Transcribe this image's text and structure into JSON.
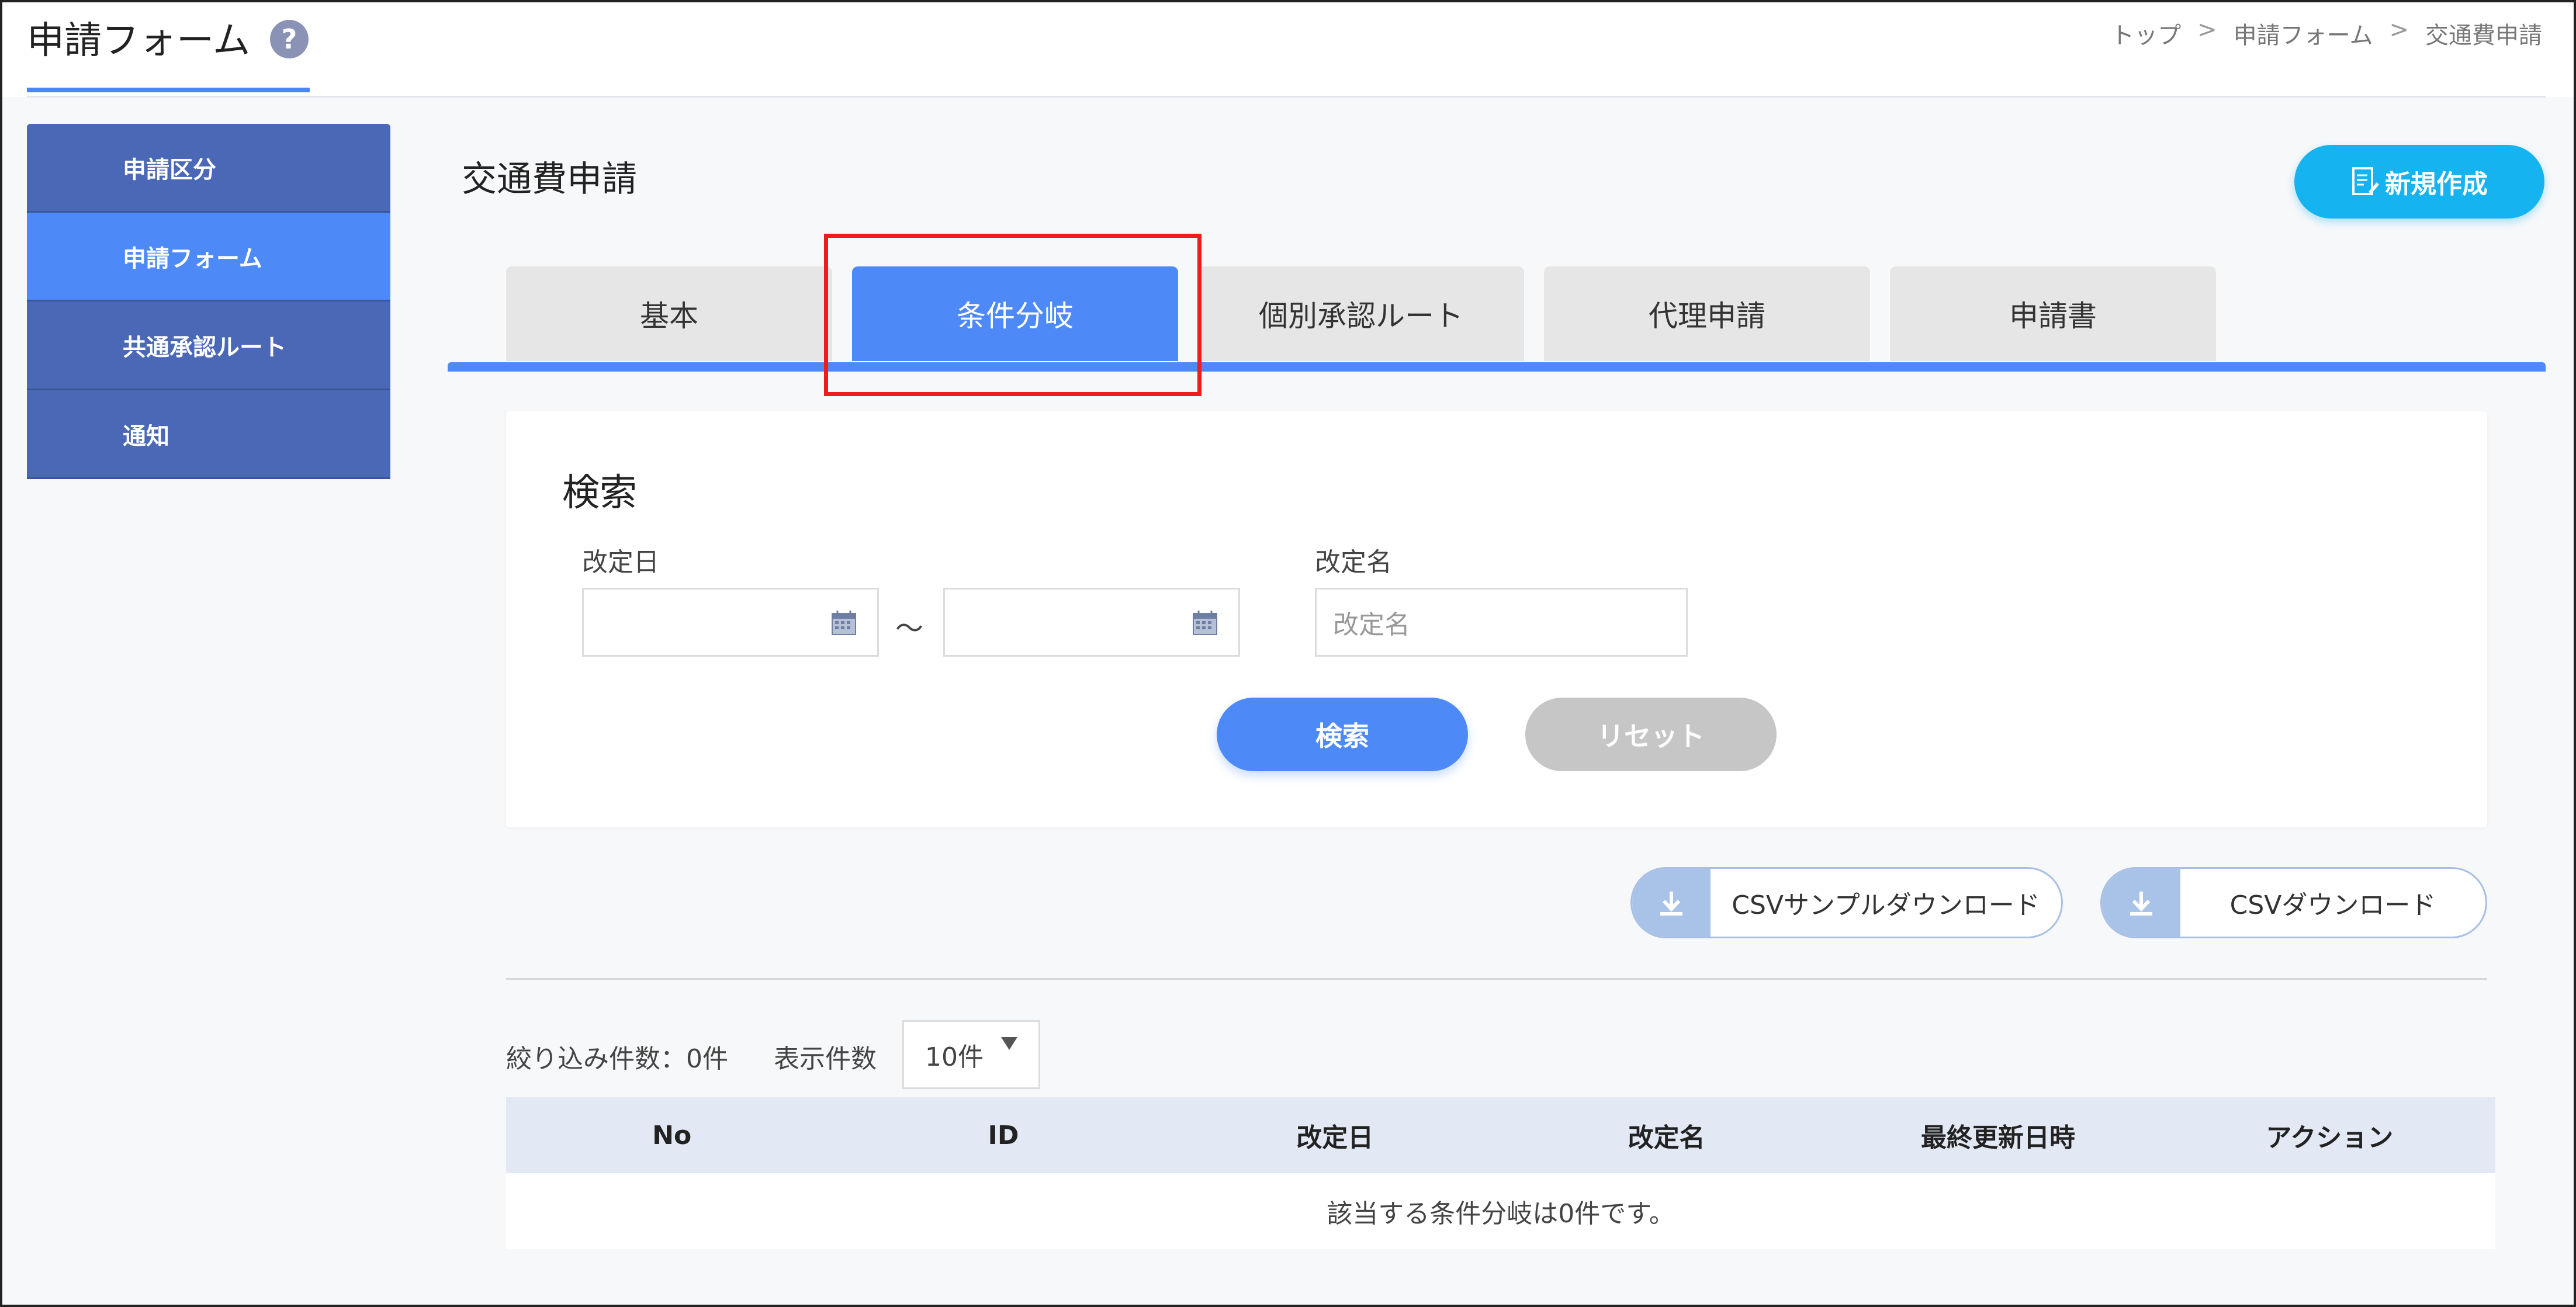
{
  "header": {
    "title": "申請フォーム",
    "help": "?",
    "breadcrumb": [
      "トップ",
      "申請フォーム",
      "交通費申請"
    ],
    "breadcrumb_sep": ">"
  },
  "sidebar": {
    "items": [
      {
        "label": "申請区分",
        "active": false
      },
      {
        "label": "申請フォーム",
        "active": true
      },
      {
        "label": "共通承認ルート",
        "active": false
      },
      {
        "label": "通知",
        "active": false
      }
    ]
  },
  "main": {
    "title": "交通費申請",
    "new_button": "新規作成",
    "tabs": [
      {
        "label": "基本",
        "active": false
      },
      {
        "label": "条件分岐",
        "active": true
      },
      {
        "label": "個別承認ルート",
        "active": false
      },
      {
        "label": "代理申請",
        "active": false
      },
      {
        "label": "申請書",
        "active": false
      }
    ]
  },
  "search": {
    "title": "検索",
    "date_label": "改定日",
    "date_from_value": "",
    "date_to_value": "",
    "range_separator": "～",
    "name_label": "改定名",
    "name_placeholder": "改定名",
    "search_button": "検索",
    "reset_button": "リセット"
  },
  "csv": {
    "sample_download": "CSVサンプルダウンロード",
    "download": "CSVダウンロード"
  },
  "list": {
    "filter_count": "絞り込み件数：0件",
    "per_page_label": "表示件数",
    "per_page_value": "10件",
    "columns": [
      "No",
      "ID",
      "改定日",
      "改定名",
      "最終更新日時",
      "アクション"
    ],
    "empty_message": "該当する条件分岐は0件です。"
  },
  "colors": {
    "accent": "#4d8af8",
    "sidebar": "#4a68b5",
    "new_button": "#15b3ef",
    "highlight": "#ee1c1c"
  }
}
